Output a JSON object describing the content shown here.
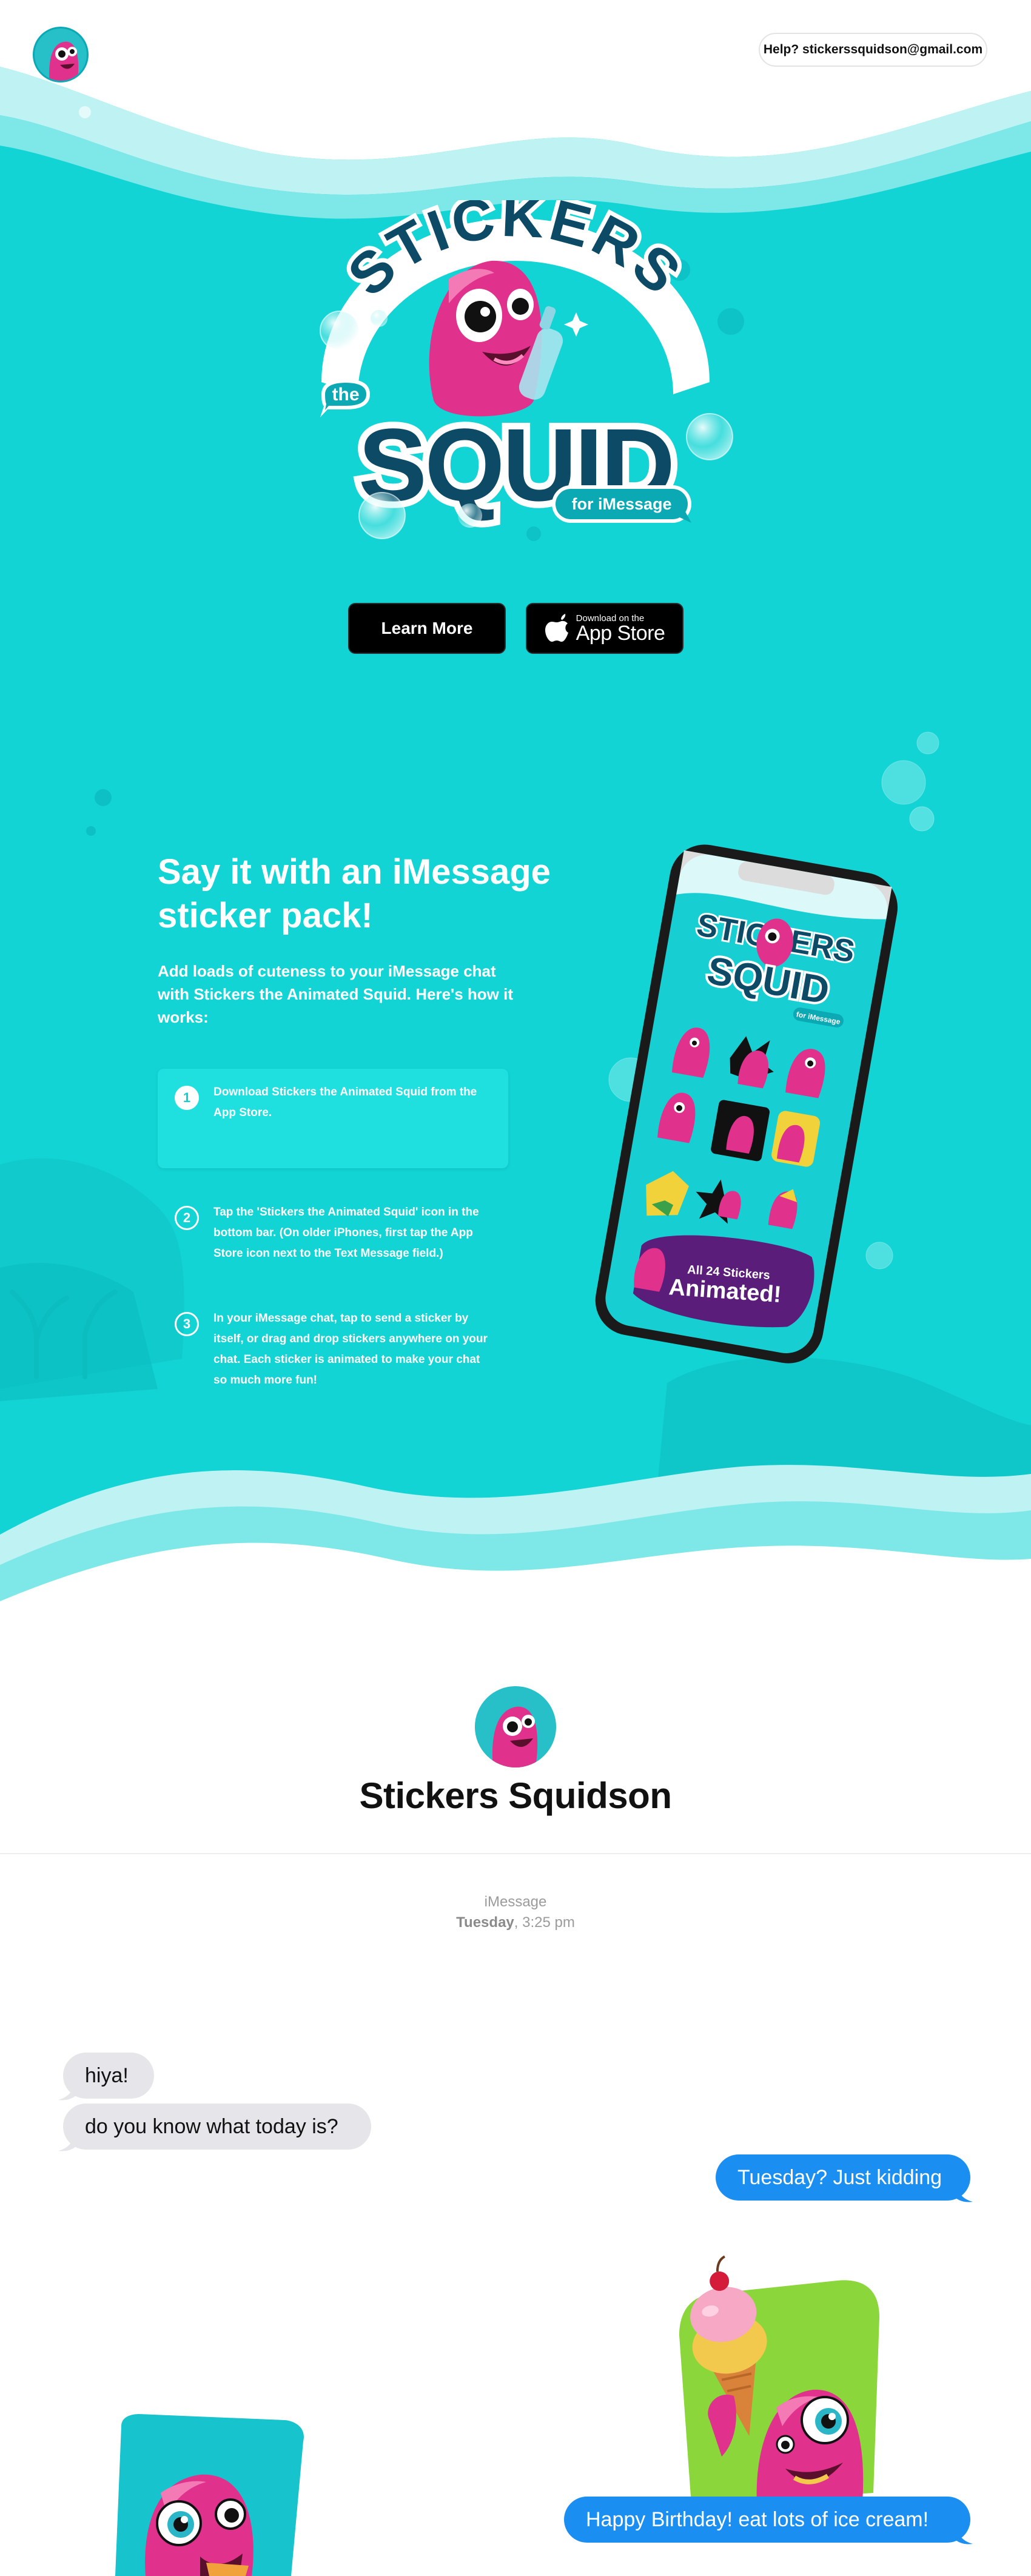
{
  "header": {
    "help_text": "Help? stickerssquidson@gmail.com",
    "avatar_icon": "squid-avatar-icon"
  },
  "logo": {
    "line1": "STICKERS",
    "the": "the",
    "line2": "SQUID",
    "for": "for iMessage"
  },
  "buttons": {
    "learn_more": "Learn More",
    "appstore_small": "Download on the",
    "appstore_big": "App Store"
  },
  "info": {
    "heading": "Say it with an iMessage sticker pack!",
    "intro": "Add loads of cuteness to your iMessage chat with Stickers the Animated Squid. Here's how it works:",
    "steps": [
      {
        "num": "1",
        "text": "Download Stickers the Animated Squid from the App Store."
      },
      {
        "num": "2",
        "text": "Tap the 'Stickers the Animated Squid' icon in the bottom bar. (On older iPhones, first tap the App Store icon next to the Text Message field.)"
      },
      {
        "num": "3",
        "text": "In your iMessage chat, tap to send a sticker by itself, or drag and drop stickers anywhere on your chat. Each sticker is animated to make your chat so much more fun!"
      }
    ],
    "phone_badge_small": "All 24 Stickers",
    "phone_badge_big": "Animated!",
    "phone_logo_small": "for iMessage"
  },
  "profile": {
    "name": "Stickers Squidson"
  },
  "chat": {
    "service": "iMessage",
    "day": "Tuesday",
    "time": ", 3:25 pm",
    "messages": [
      {
        "from": "them",
        "text": "hiya!"
      },
      {
        "from": "them",
        "text": "do you know what today is?"
      },
      {
        "from": "me",
        "text": "Tuesday? Just kidding"
      },
      {
        "from": "me",
        "text": "Happy Birthday! eat lots of ice cream!"
      }
    ]
  },
  "colors": {
    "sea": "#12d4d4",
    "squid": "#e0318d",
    "bubble_out": "#1b8ef2",
    "bubble_in": "#e6e6ea"
  }
}
